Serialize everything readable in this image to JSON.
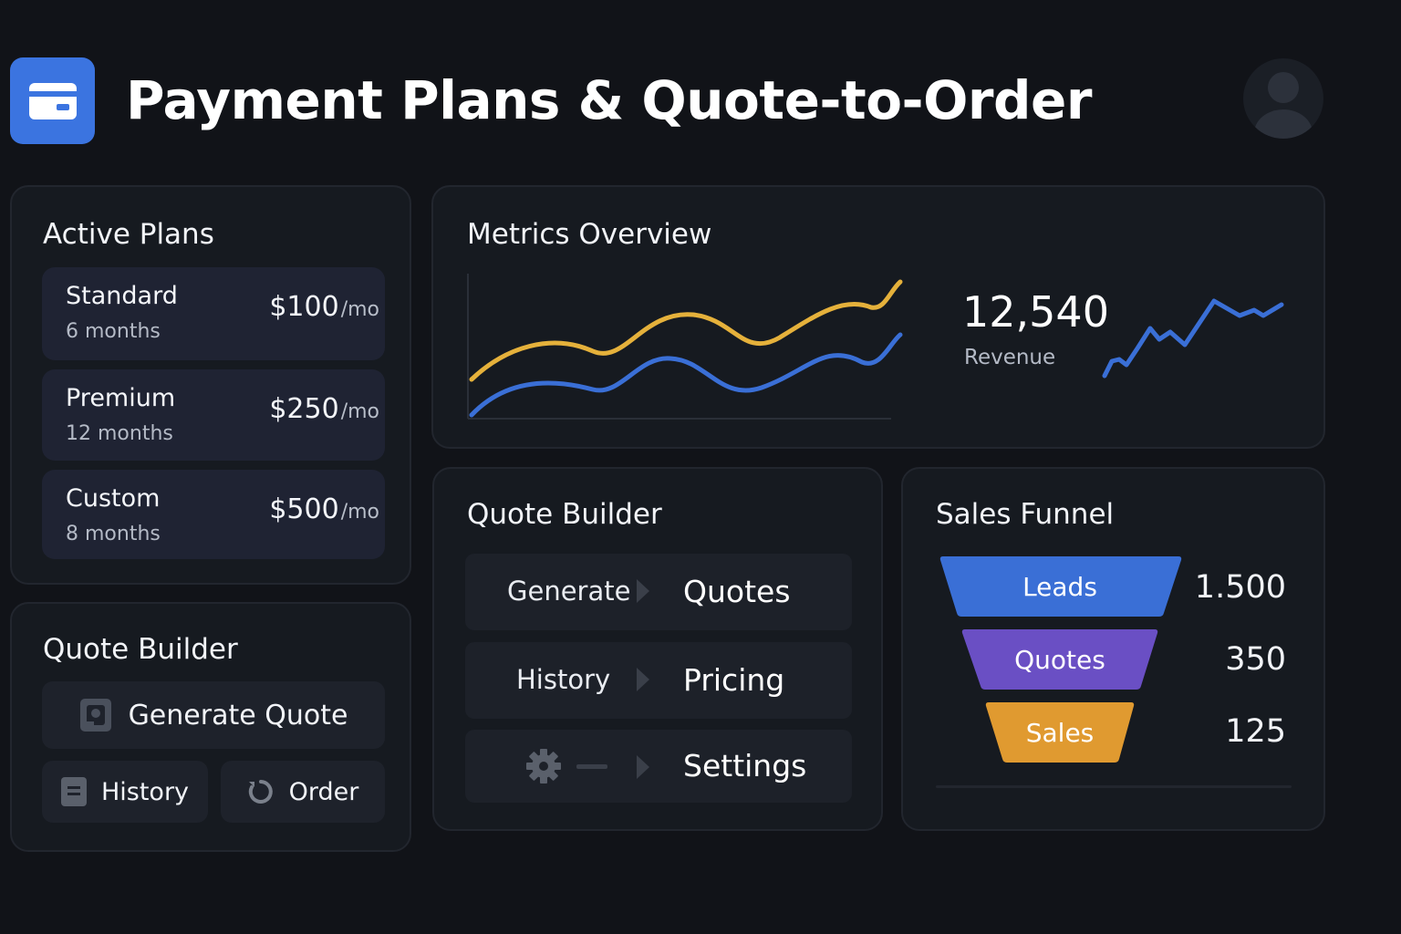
{
  "header": {
    "title": "Payment Plans & Quote-to-Order",
    "logo_icon": "credit-card-icon",
    "avatar_icon": "user-avatar-icon"
  },
  "active_plans": {
    "title": "Active Plans",
    "plans": [
      {
        "name": "Standard",
        "term": "6 months",
        "price": "$100",
        "period": "/mo"
      },
      {
        "name": "Premium",
        "term": "12 months",
        "price": "$250",
        "period": "/mo"
      },
      {
        "name": "Custom",
        "term": "8 months",
        "price": "$500",
        "period": "/mo"
      }
    ]
  },
  "quote_builder_left": {
    "title": "Quote Builder",
    "generate_label": "Generate Quote",
    "history_label": "History",
    "order_label": "Order"
  },
  "metrics": {
    "title": "Metrics Overview",
    "revenue_value": "12,540",
    "revenue_label": "Revenue"
  },
  "quote_builder_mid": {
    "title": "Quote Builder",
    "rows": [
      {
        "left": "Generate",
        "right": "Quotes"
      },
      {
        "left": "History",
        "right": "Pricing"
      },
      {
        "left": "",
        "right": "Settings"
      }
    ]
  },
  "sales_funnel": {
    "title": "Sales Funnel",
    "stages": [
      {
        "label": "Leads",
        "value": "1.500"
      },
      {
        "label": "Quotes",
        "value": "350"
      },
      {
        "label": "Sales",
        "value": "125"
      }
    ]
  },
  "colors": {
    "accent_blue": "#3b74e0",
    "series_yellow": "#e5b13b",
    "series_blue": "#3a6fd6",
    "funnel_leads": "#3a6fd6",
    "funnel_quotes": "#6a4fc4",
    "funnel_sales": "#e09a30"
  }
}
